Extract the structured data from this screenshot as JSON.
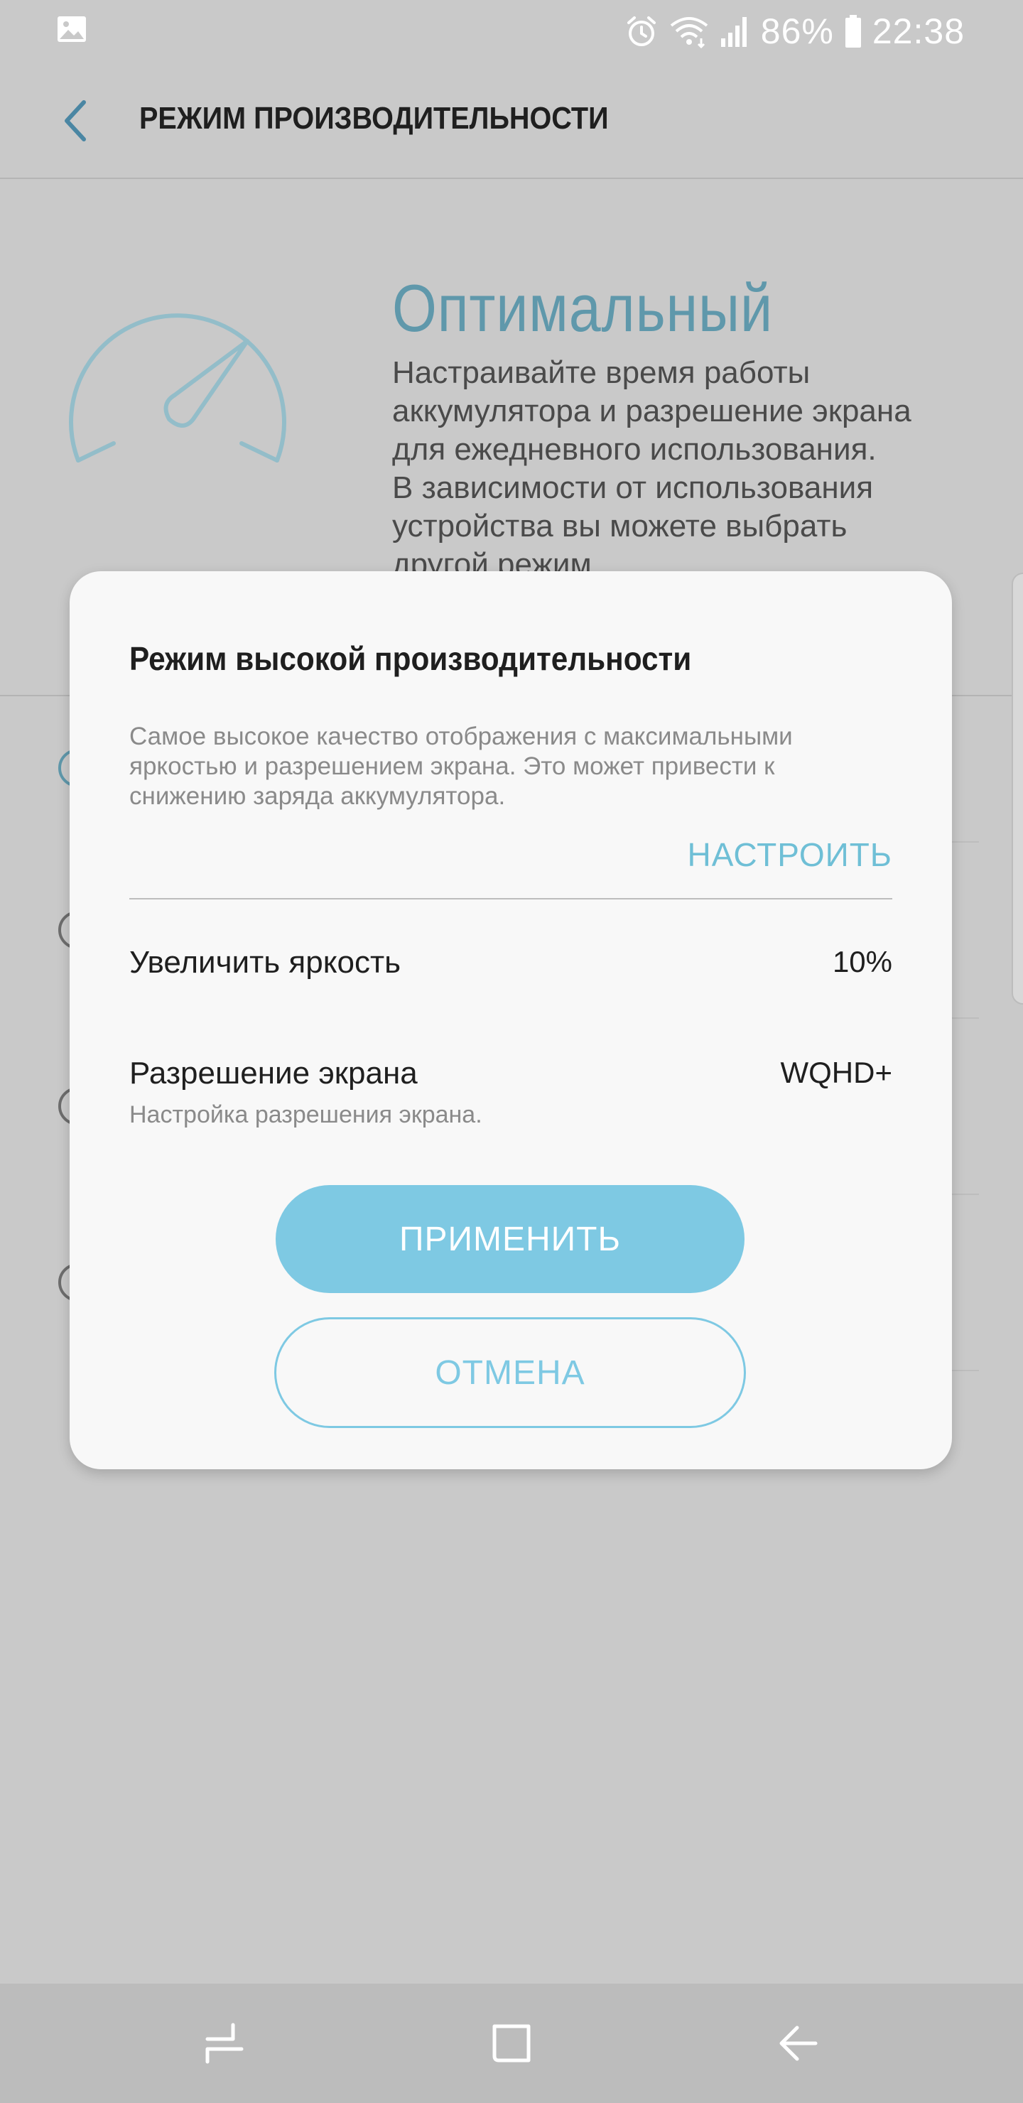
{
  "status_bar": {
    "battery_percent": "86%",
    "time": "22:38",
    "icons": [
      "gallery-icon",
      "alarm-icon",
      "wifi-icon",
      "signal-icon",
      "battery-icon"
    ]
  },
  "app_bar": {
    "title": "РЕЖИМ ПРОИЗВОДИТЕЛЬНОСТИ",
    "back_icon": "chevron-left-icon"
  },
  "current_mode": {
    "title": "Оптимальный",
    "description": "Настраивайте время работы\nаккумулятора и разрешение экрана\nдля ежедневного использования.\nВ зависимости от использования\nустройства вы можете выбрать\nдругой режим.",
    "icon": "gauge-icon"
  },
  "dialog": {
    "title": "Режим высокой производительности",
    "description": "Самое высокое качество отображения с максимальными\nяркостью и разрешением экрана. Это может привести к\nснижению заряда аккумулятора.",
    "configure_label": "НАСТРОИТЬ",
    "settings": {
      "brightness": {
        "label": "Увеличить яркость",
        "value": "10%"
      },
      "resolution": {
        "label": "Разрешение экрана",
        "value": "WQHD+",
        "sub": "Настройка разрешения экрана."
      }
    },
    "apply_label": "ПРИМЕНИТЬ",
    "cancel_label": "ОТМЕНА"
  },
  "colors": {
    "accent": "#7ec9e3",
    "mode_title": "#5f98ab",
    "scrim_background": "#c9c9c9",
    "dialog_background": "#f8f8f8"
  },
  "nav_bar": {
    "icons": [
      "recents-icon",
      "home-icon",
      "back-icon"
    ]
  }
}
